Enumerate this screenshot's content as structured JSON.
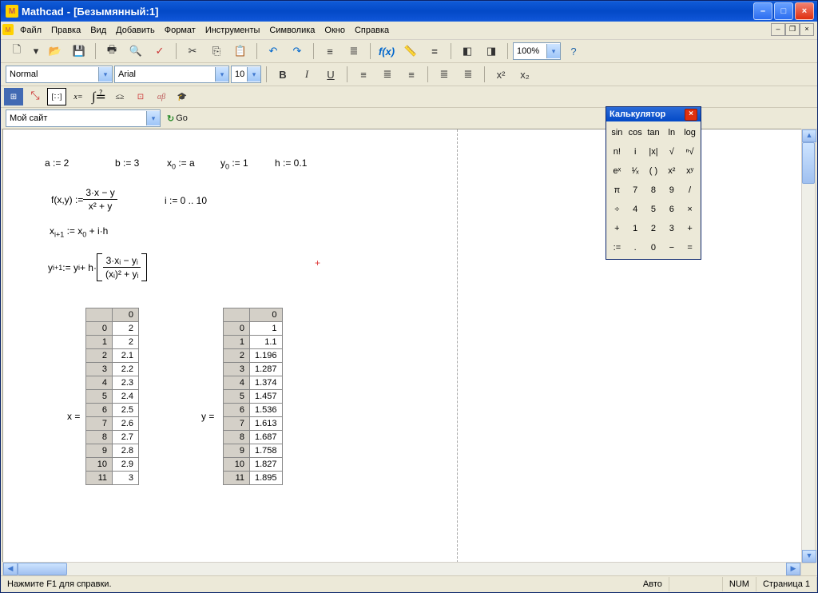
{
  "titlebar": {
    "app": "Mathcad",
    "doc": "[Безымянный:1]"
  },
  "menu": {
    "items": [
      "Файл",
      "Правка",
      "Вид",
      "Добавить",
      "Формат",
      "Инструменты",
      "Символика",
      "Окно",
      "Справка"
    ]
  },
  "fmt": {
    "style": "Normal",
    "font": "Arial",
    "size": "10",
    "zoom": "100%",
    "site": "Мой сайт",
    "go": "Go"
  },
  "calc": {
    "title": "Калькулятор",
    "keys": [
      "sin",
      "cos",
      "tan",
      "ln",
      "log",
      "n!",
      "i",
      "|x|",
      "√",
      "ⁿ√",
      "eˣ",
      "¹∕ₓ",
      "( )",
      "x²",
      "xʸ",
      "π",
      "7",
      "8",
      "9",
      "/",
      "÷",
      "4",
      "5",
      "6",
      "×",
      "+",
      "1",
      "2",
      "3",
      "+",
      ":=",
      ".",
      "0",
      "−",
      "="
    ]
  },
  "math": {
    "a": "a := 2",
    "b": "b := 3",
    "x0": "x",
    "x0s": "0",
    "x0r": " := a",
    "y0": "y",
    "y0s": "0",
    "y0r": " := 1",
    "h": "h := 0.1",
    "f_lhs": "f(x,y) := ",
    "f_num": "3·x − y",
    "f_den": "x² + y",
    "irange": "i := 0 .. 10",
    "xrec_l": "x",
    "xrec_s": "i+1",
    "xrec_r": " := x",
    "xrec_s2": "0",
    "xrec_end": " + i·h",
    "yrec_l": "y",
    "yrec_s": "i+1",
    "yrec_mid": " := y",
    "yrec_s2": "i",
    "yrec_h": " + h·",
    "yrec_num": "3·xᵢ − yᵢ",
    "yrec_den": "(xᵢ)² + yᵢ",
    "x_label": "x =",
    "y_label": "y ="
  },
  "xtable": {
    "header": "0",
    "idx": [
      "0",
      "1",
      "2",
      "3",
      "4",
      "5",
      "6",
      "7",
      "8",
      "9",
      "10",
      "11"
    ],
    "vals": [
      "2",
      "2",
      "2.1",
      "2.2",
      "2.3",
      "2.4",
      "2.5",
      "2.6",
      "2.7",
      "2.8",
      "2.9",
      "3"
    ]
  },
  "ytable": {
    "header": "0",
    "idx": [
      "0",
      "1",
      "2",
      "3",
      "4",
      "5",
      "6",
      "7",
      "8",
      "9",
      "10",
      "11"
    ],
    "vals": [
      "1",
      "1.1",
      "1.196",
      "1.287",
      "1.374",
      "1.457",
      "1.536",
      "1.613",
      "1.687",
      "1.758",
      "1.827",
      "1.895"
    ]
  },
  "status": {
    "help": "Нажмите F1 для справки.",
    "auto": "Авто",
    "num": "NUM",
    "page": "Страница 1"
  }
}
